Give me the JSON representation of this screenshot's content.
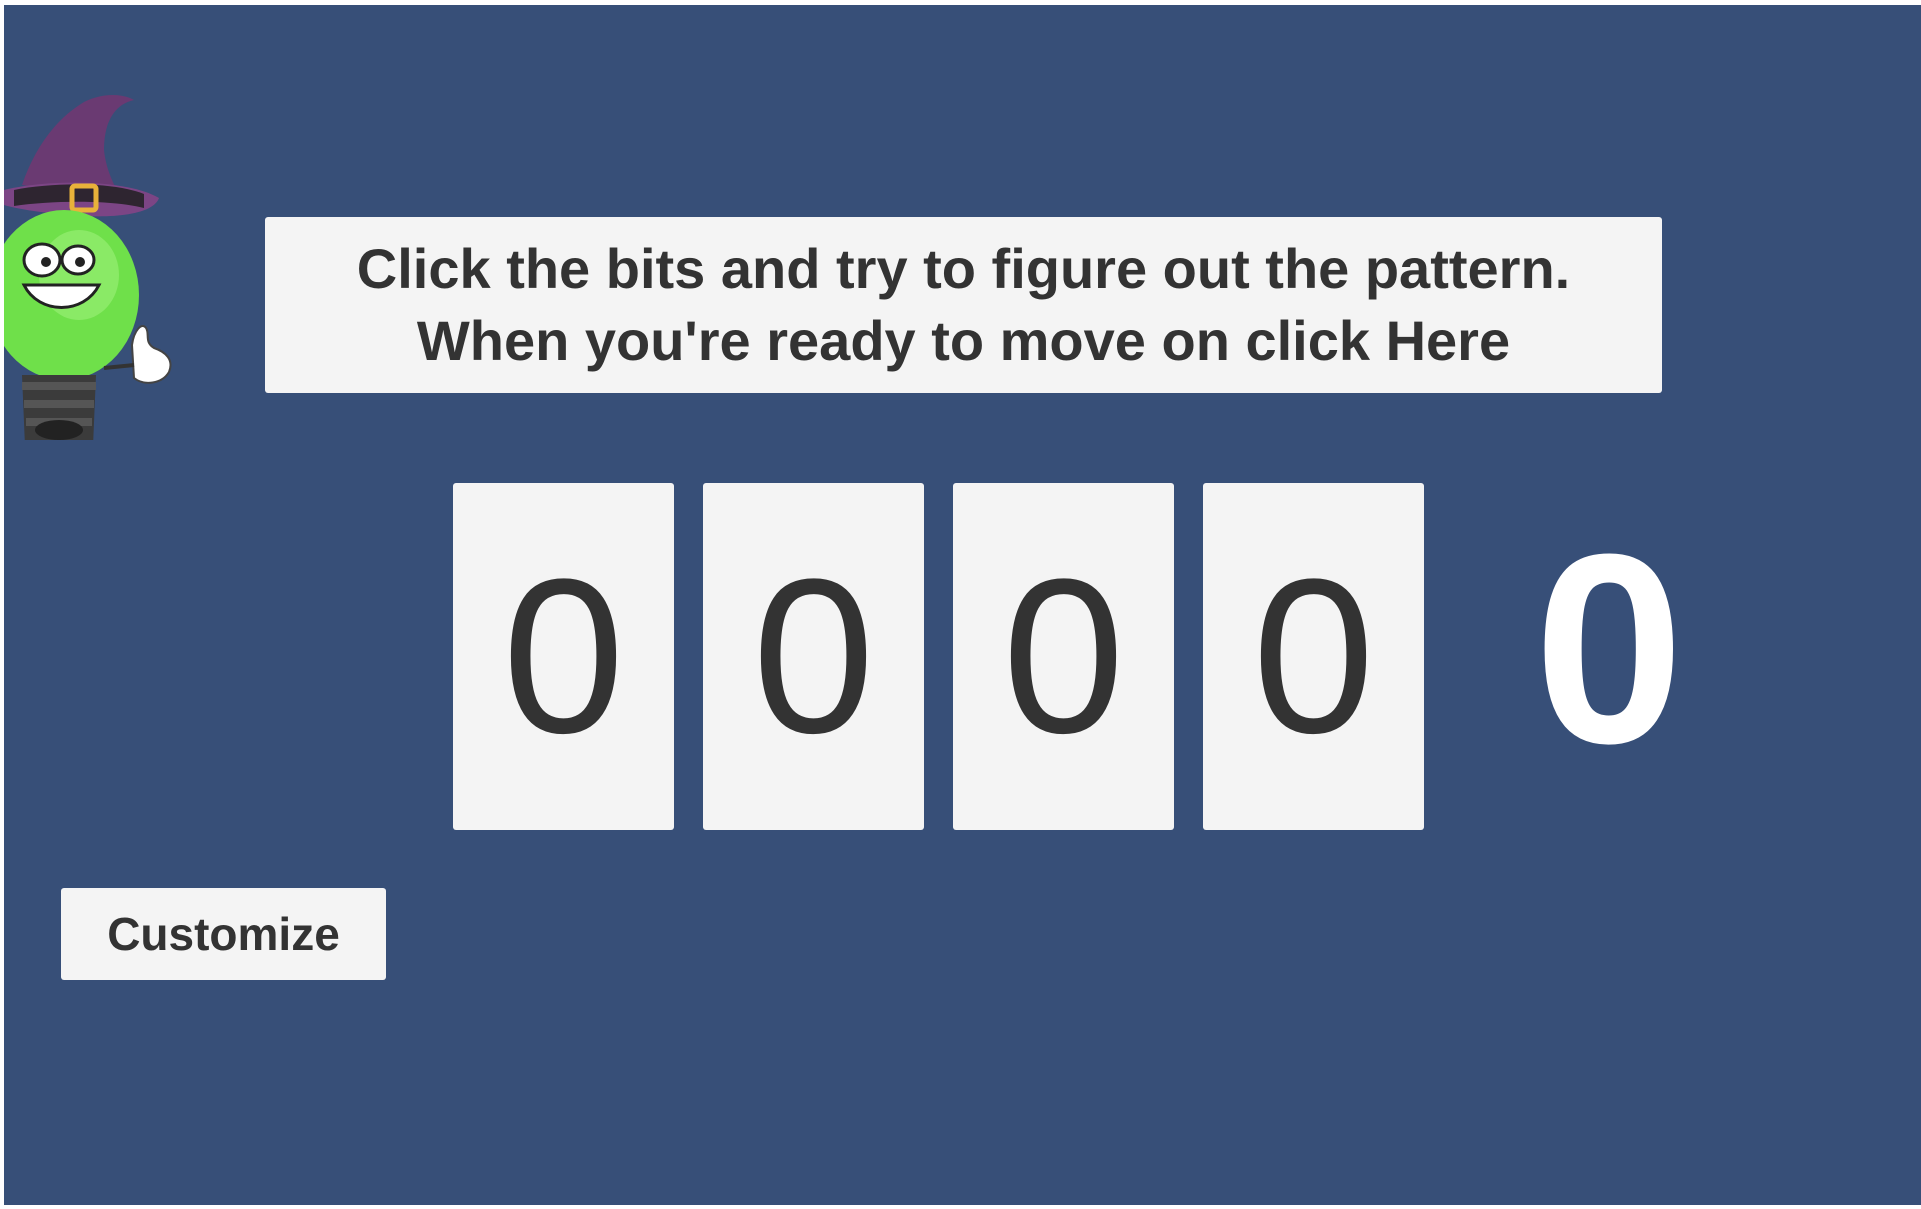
{
  "instructions": {
    "line1": "Click the bits and try to figure out the pattern.",
    "line2": "When you're ready to move on click Here"
  },
  "bits": [
    "0",
    "0",
    "0",
    "0"
  ],
  "decimal_value": "0",
  "customize_label": "Customize",
  "colors": {
    "background": "#374f78",
    "card": "#f4f4f4",
    "text": "#333333",
    "decimal_text": "#ffffff",
    "mascot_bulb": "#6fe04a",
    "mascot_hat": "#6a3a72"
  },
  "mascot": "wizard-lightbulb-mascot"
}
